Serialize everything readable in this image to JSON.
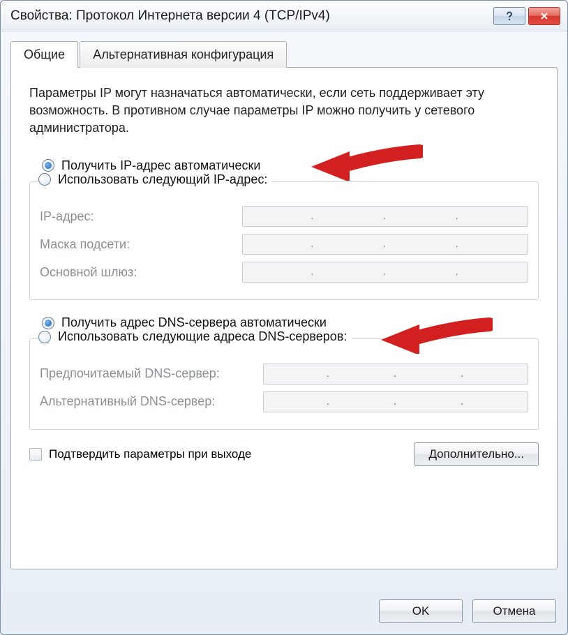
{
  "window": {
    "title": "Свойства: Протокол Интернета версии 4 (TCP/IPv4)"
  },
  "tabs": {
    "general": "Общие",
    "alternate": "Альтернативная конфигурация"
  },
  "intro": "Параметры IP могут назначаться автоматически, если сеть поддерживает эту возможность. В противном случае параметры IP можно получить у сетевого администратора.",
  "ip_section": {
    "auto_label": "Получить IP-адрес автоматически",
    "auto_checked": true,
    "manual_label": "Использовать следующий IP-адрес:",
    "manual_checked": false,
    "fields": {
      "ip": "IP-адрес:",
      "mask": "Маска подсети:",
      "gateway": "Основной шлюз:"
    }
  },
  "dns_section": {
    "auto_label": "Получить адрес DNS-сервера автоматически",
    "auto_checked": true,
    "manual_label": "Использовать следующие адреса DNS-серверов:",
    "manual_checked": false,
    "fields": {
      "preferred": "Предпочитаемый DNS-сервер:",
      "alternate": "Альтернативный DNS-сервер:"
    }
  },
  "validate_checkbox": {
    "label": "Подтвердить параметры при выходе",
    "checked": false
  },
  "buttons": {
    "advanced": "Дополнительно...",
    "ok": "OK",
    "cancel": "Отмена"
  },
  "icons": {
    "help": "help-icon",
    "close": "close-icon"
  }
}
